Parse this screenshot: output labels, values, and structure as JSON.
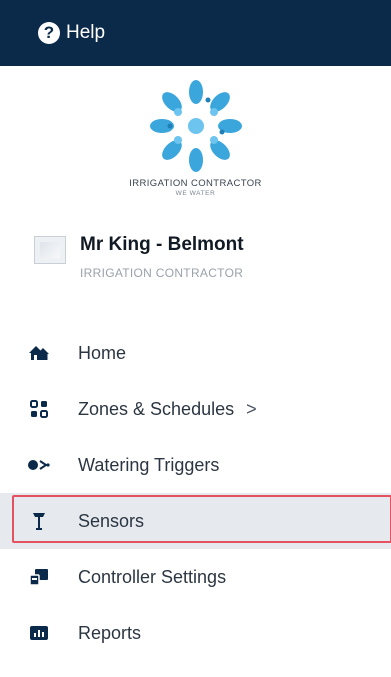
{
  "topbar": {
    "help_label": "Help",
    "help_icon_glyph": "?",
    "background": "#0b2a4a"
  },
  "logo": {
    "name": "IRRIGATION CONTRACTOR",
    "tagline": "WE WATER",
    "color": "#3aa6dc"
  },
  "account": {
    "name": "Mr King - Belmont",
    "role": "IRRIGATION CONTRACTOR"
  },
  "nav": {
    "items": [
      {
        "label": "Home",
        "icon": "home-icon"
      },
      {
        "label": "Zones & Schedules",
        "icon": "grid-icon",
        "chevron": ">"
      },
      {
        "label": "Watering Triggers",
        "icon": "trigger-icon"
      },
      {
        "label": "Sensors",
        "icon": "sensor-icon",
        "active": true
      },
      {
        "label": "Controller Settings",
        "icon": "controller-icon"
      },
      {
        "label": "Reports",
        "icon": "reports-icon"
      }
    ]
  },
  "colors": {
    "highlight_border": "#e4525f",
    "active_background": "#e6eaef"
  }
}
